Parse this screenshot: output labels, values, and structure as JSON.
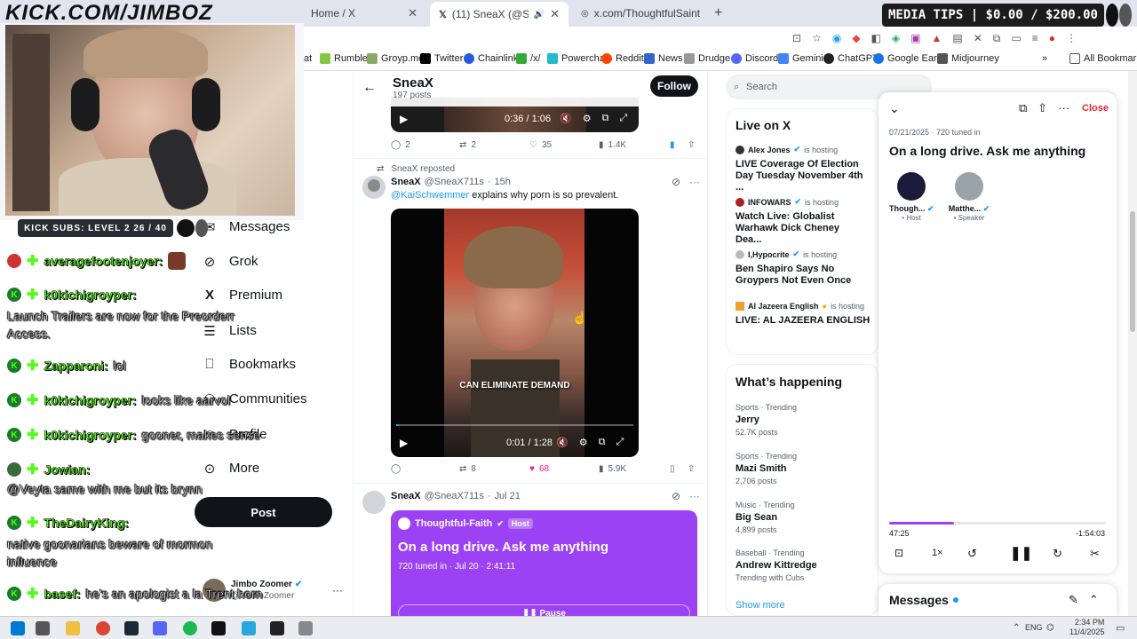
{
  "overlay": {
    "url_text": "KICK.COM/JIMBOZ",
    "media_tips": "MEDIA TIPS | $0.00 / $200.00",
    "kick_subs": "KICK SUBS: LEVEL 2 26 / 40"
  },
  "chat": [
    {
      "name": "averagefootenjoyer:",
      "text": "",
      "badge": "red"
    },
    {
      "name": "k0kichigroyper:",
      "text": "",
      "badge": "k"
    },
    {
      "name": "",
      "text": "Launch Trailers are now for the Preorderr Access.",
      "badge": ""
    },
    {
      "name": "Zapparoni:",
      "text": "lol",
      "badge": "k"
    },
    {
      "name": "k0kichigroyper:",
      "text": "looks like aarvol",
      "badge": "k"
    },
    {
      "name": "k0kichigroyper:",
      "text": "gooner, makes sense",
      "badge": "k"
    },
    {
      "name": "Jowian:",
      "text": "",
      "badge": "green"
    },
    {
      "name": "",
      "text": "@Veyta same with me but its brynn",
      "badge": ""
    },
    {
      "name": "TheDairyKing:",
      "text": "",
      "badge": "k"
    },
    {
      "name": "",
      "text": "native goonarians beware of mormon influence",
      "badge": ""
    },
    {
      "name": "basef:",
      "text": "he's an apologist a la Trent horn",
      "badge": "k"
    }
  ],
  "browser": {
    "tabs": [
      {
        "label": "Home / X"
      },
      {
        "label": "(11) SneaX (@SneaX711s) /"
      },
      {
        "label": "x.com/ThoughtfulSaint"
      }
    ],
    "bookmarks": [
      "at",
      "Rumble",
      "Groyp.me",
      "Twitter",
      "Chainlink",
      "/x/",
      "Powerchat",
      "Reddit",
      "News",
      "Drudge",
      "Discord",
      "Gemini",
      "ChatGPT",
      "Google Earth",
      "Midjourney",
      "All Bookmarks"
    ]
  },
  "nav": {
    "items": [
      "Messages",
      "Grok",
      "Premium",
      "Lists",
      "Bookmarks",
      "Communities",
      "Profile",
      "More"
    ],
    "post_label": "Post",
    "account_name": "Jimbo Zoomer",
    "account_handle": "@JimboZoomer"
  },
  "profile_header": {
    "name": "SneaX",
    "posts": "197 posts",
    "follow_label": "Follow"
  },
  "post_top": {
    "time": "0:36 / 1:06",
    "replies": "2",
    "reposts": "2",
    "likes": "35",
    "views": "1.4K"
  },
  "post_main": {
    "repost_label": "SneaX reposted",
    "name": "SneaX",
    "handle": "@SneaX711s",
    "age": "15h",
    "mention": "@KaiSchwemmer",
    "text": "explains why porn is so prevalent.",
    "caption": "CAN ELIMINATE DEMAND",
    "time": "0:01 / 1:28",
    "reposts": "8",
    "likes": "68",
    "views": "5.9K"
  },
  "post_third": {
    "name": "SneaX",
    "handle": "@SneaX711s",
    "age": "Jul 21",
    "space_host": "Thoughtful-Faith",
    "host_badge": "Host",
    "space_title": "On a long drive. Ask me anything",
    "space_meta": "720 tuned in · Jul 20 · 2:41:11",
    "pause_label": "Pause"
  },
  "search": {
    "placeholder": "Search"
  },
  "live": {
    "heading": "Live on X",
    "hosting_label": "is hosting",
    "items": [
      {
        "host": "Alex Jones",
        "title": "LIVE Coverage Of Election Day Tuesday November 4th ..."
      },
      {
        "host": "INFOWARS",
        "title": "Watch Live: Globalist Warhawk Dick Cheney Dea..."
      },
      {
        "host": "I,Hypocrite",
        "title": "Ben Shapiro Says No Groypers Not Even Once"
      },
      {
        "host": "Al Jazeera English",
        "title": "LIVE: AL JAZEERA ENGLISH"
      }
    ]
  },
  "happening": {
    "heading": "What’s happening",
    "trends": [
      {
        "cat": "Sports · Trending",
        "name": "Jerry",
        "count": "52.7K posts"
      },
      {
        "cat": "Sports · Trending",
        "name": "Mazi Smith",
        "count": "2,706 posts"
      },
      {
        "cat": "Music · Trending",
        "name": "Big Sean",
        "count": "4,899 posts"
      },
      {
        "cat": "Baseball · Trending",
        "name": "Andrew Kittredge",
        "count": "Trending with Cubs"
      }
    ],
    "show_more": "Show more"
  },
  "space_panel": {
    "close_label": "Close",
    "meta": "07/21/2025 · 720 tuned in",
    "title": "On a long drive. Ask me anything",
    "host_name": "Though...",
    "host_role": "Host",
    "speaker_name": "Matthe...",
    "speaker_role": "Speaker",
    "elapsed": "47:25",
    "remaining": "-1:54:03",
    "speed": "1×",
    "progress": 0.3
  },
  "messages_drawer": {
    "label": "Messages"
  },
  "tray": {
    "lang": "ENG",
    "time": "2:34 PM",
    "date": "11/4/2025"
  },
  "colors": {
    "accent": "#1d9bf0",
    "space_purple": "#9b42f5",
    "kick_green": "#53fc18",
    "like_pink": "#f91880"
  }
}
